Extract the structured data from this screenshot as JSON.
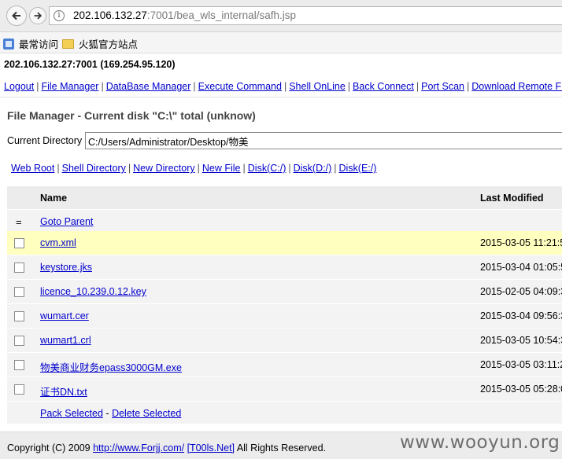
{
  "browser": {
    "url_host": "202.106.132.27",
    "url_rest": ":7001/bea_wls_internal/safh.jsp",
    "bookmarks": [
      "最常访问",
      "火狐官方站点"
    ]
  },
  "page": {
    "host_line": "202.106.132.27:7001 (169.254.95.120)",
    "menu": [
      "Logout",
      "File Manager",
      "DataBase Manager",
      "Execute Command",
      "Shell OnLine",
      "Back Connect",
      "Port Scan",
      "Download Remote File"
    ],
    "title": "File Manager - Current disk \"C:\\\" total (unknow)",
    "current_dir_label": "Current Directory",
    "current_dir_value": "C:/Users/Administrator/Desktop/物美",
    "quick_links": [
      "Web Root",
      "Shell Directory",
      "New Directory",
      "New File",
      "Disk(C:/)",
      "Disk(D:/)",
      "Disk(E:/)"
    ],
    "table": {
      "col_name": "Name",
      "col_modified": "Last Modified",
      "parent_mark": "=",
      "goto_parent": "Goto Parent",
      "files": [
        {
          "name": "cvm.xml",
          "modified": "2015-03-05 11:21:5"
        },
        {
          "name": "keystore.jks",
          "modified": "2015-03-04 01:05:5"
        },
        {
          "name": "licence_10.239.0.12.key",
          "modified": "2015-02-05 04:09:3"
        },
        {
          "name": "wumart.cer",
          "modified": "2015-03-04 09:56:3"
        },
        {
          "name": "wumart1.crl",
          "modified": "2015-03-05 10:54:3"
        },
        {
          "name": "物美商业财务epass3000GM.exe",
          "modified": "2015-03-05 03:11:2"
        },
        {
          "name": "证书DN.txt",
          "modified": "2015-03-05 05:28:0"
        }
      ],
      "pack_selected": "Pack Selected",
      "action_sep": "-",
      "delete_selected": "Delete Selected"
    },
    "footer": {
      "copyright_prefix": "Copyright (C) 2009",
      "link1": "http://www.Forjj.com/",
      "link2": "[T00ls.Net]",
      "suffix": "All Rights Reserved."
    },
    "watermark": "www.wooyun.org"
  }
}
